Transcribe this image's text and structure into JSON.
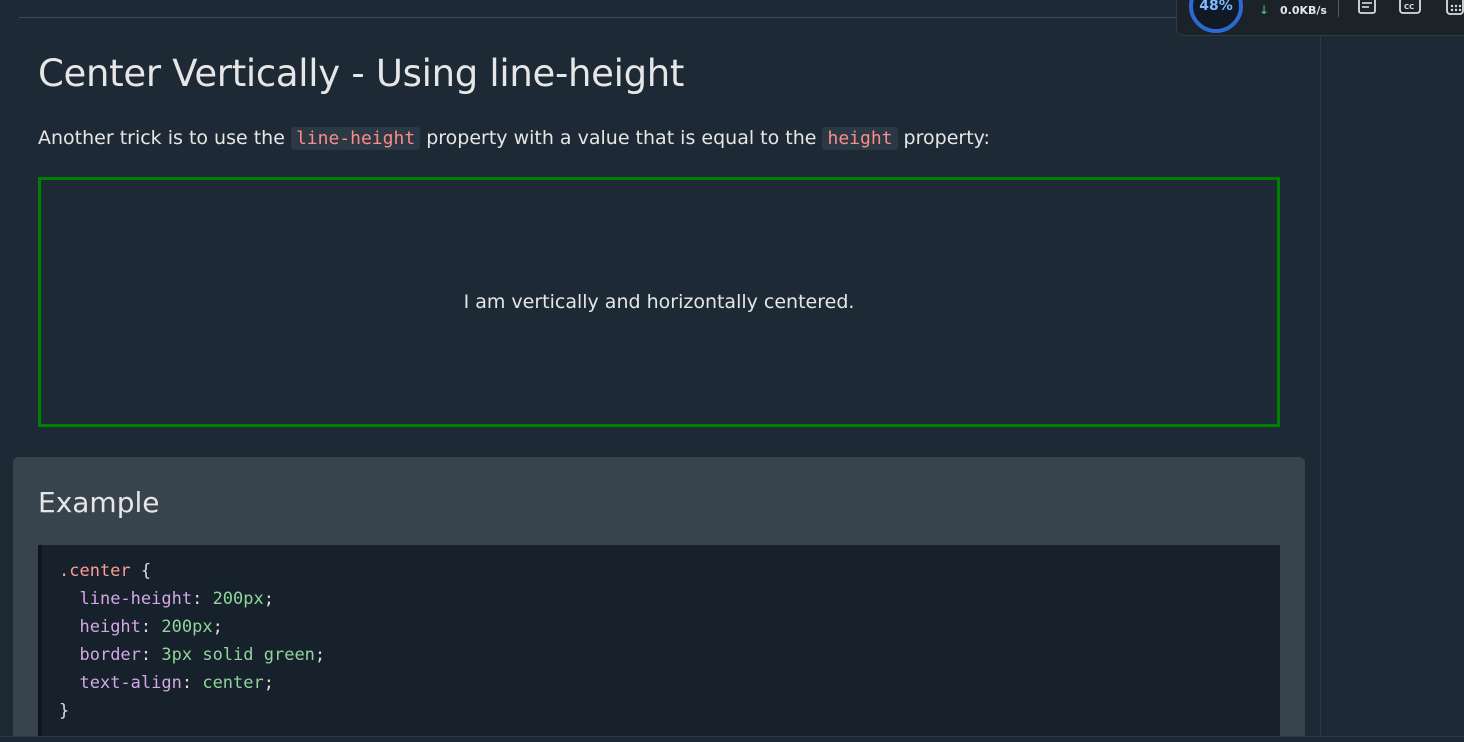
{
  "content": {
    "heading": "Center Vertically - Using line-height",
    "intro_before": "Another trick is to use the ",
    "intro_code1": "line-height",
    "intro_middle": " property with a value that is equal to the ",
    "intro_code2": "height",
    "intro_after": " property:",
    "demo_text": "I am vertically and horizontally centered."
  },
  "example": {
    "title": "Example",
    "code": {
      "selector": ".center",
      "open_brace": "{",
      "lines": [
        {
          "prop": "line-height",
          "value": "200px"
        },
        {
          "prop": "height",
          "value": "200px"
        },
        {
          "prop": "border",
          "value": "3px solid green"
        },
        {
          "prop": "text-align",
          "value": "center"
        }
      ],
      "close_brace": "}"
    }
  },
  "overlay": {
    "cpu_percent": "48%",
    "net_speed": "0.0KB/s",
    "icons": [
      "notes-icon",
      "captions-icon",
      "calculator-icon"
    ]
  },
  "colors": {
    "page_bg": "#1d2a35",
    "demo_border": "#008000",
    "code_selector": "#ff9a9a",
    "code_property": "#d2a8e6",
    "code_value": "#90d59b"
  }
}
